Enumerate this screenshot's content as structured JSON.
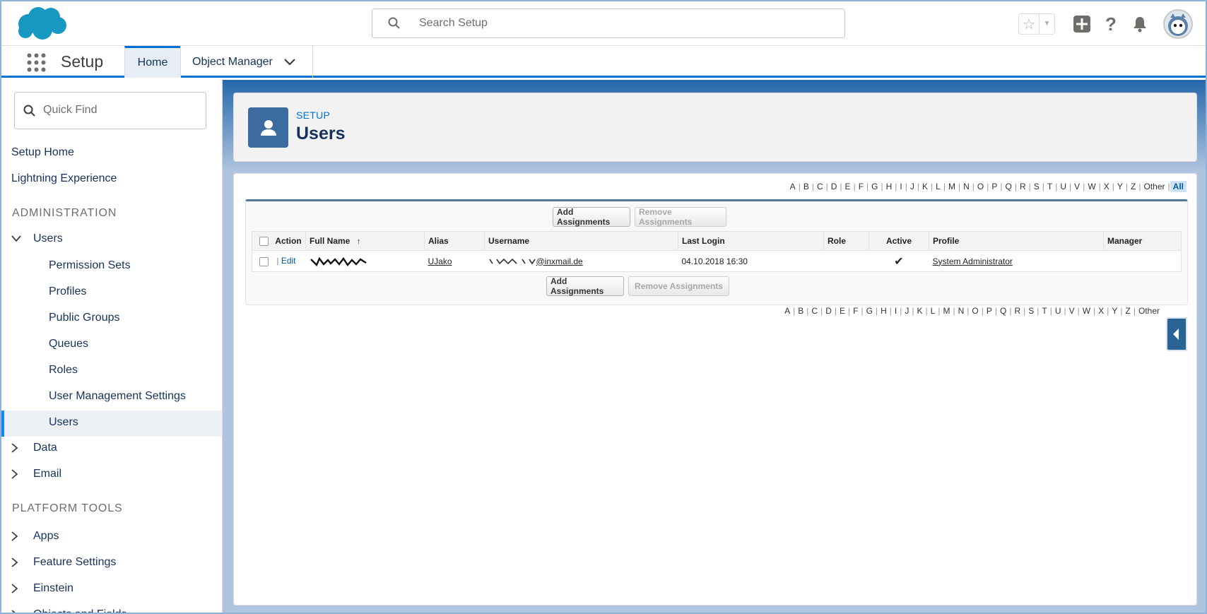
{
  "header": {
    "search_placeholder": "Search Setup",
    "icons": [
      "salesforce-logo",
      "search-icon",
      "star-icon",
      "chevron-down-icon",
      "plus-icon",
      "help-icon",
      "bell-icon",
      "avatar"
    ]
  },
  "context_nav": {
    "app_name": "Setup",
    "tabs": [
      {
        "label": "Home",
        "selected": true
      },
      {
        "label": "Object Manager",
        "selected": false
      }
    ]
  },
  "sidebar": {
    "quick_find_placeholder": "Quick Find",
    "top_items": [
      "Setup Home",
      "Lightning Experience"
    ],
    "administration": {
      "heading": "ADMINISTRATION",
      "users_group": "Users",
      "users_children": [
        "Permission Sets",
        "Profiles",
        "Public Groups",
        "Queues",
        "Roles",
        "User Management Settings",
        "Users"
      ],
      "selected": "Users",
      "other_groups": [
        "Data",
        "Email"
      ]
    },
    "platform_tools": {
      "heading": "PLATFORM TOOLS",
      "groups": [
        "Apps",
        "Feature Settings",
        "Einstein",
        "Objects and Fields"
      ]
    }
  },
  "page_header": {
    "breadcrumb": "SETUP",
    "title": "Users"
  },
  "alpha_filter": {
    "letters": [
      "A",
      "B",
      "C",
      "D",
      "E",
      "F",
      "G",
      "H",
      "I",
      "J",
      "K",
      "L",
      "M",
      "N",
      "O",
      "P",
      "Q",
      "R",
      "S",
      "T",
      "U",
      "V",
      "W",
      "X",
      "Y",
      "Z",
      "Other"
    ],
    "all_label": "All",
    "selected": "All"
  },
  "list_view": {
    "add_assignments": "Add Assignments",
    "remove_assignments": "Remove Assignments",
    "columns": [
      "Action",
      "Full Name",
      "Alias",
      "Username",
      "Last Login",
      "Role",
      "Active",
      "Profile",
      "Manager"
    ],
    "sort_indicator": "↑",
    "rows": [
      {
        "action_sep": "|",
        "action": "Edit",
        "full_name": "",
        "alias": "UJako",
        "username_suffix": "@inxmail.de",
        "last_login": "04.10.2018 16:30",
        "role": "",
        "active": "✔",
        "profile": "System Administrator",
        "manager": ""
      }
    ]
  },
  "colors": {
    "brand_blue": "#0070d2",
    "header_icon": "#3c6ba0",
    "banner": "#1e63a8"
  }
}
